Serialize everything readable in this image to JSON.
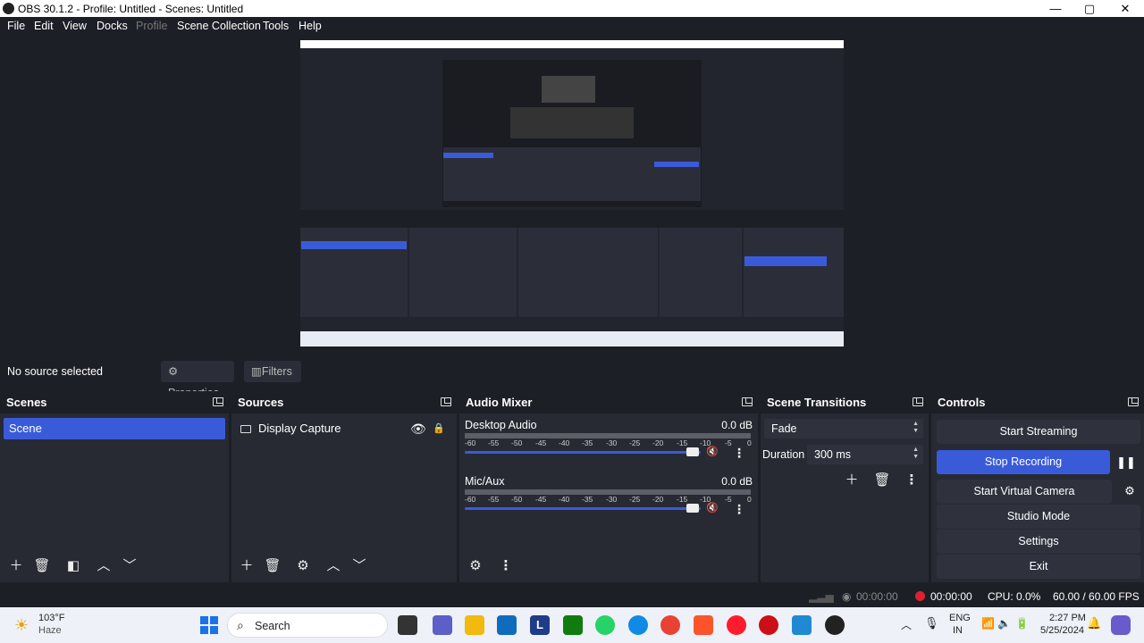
{
  "window": {
    "title": "OBS 30.1.2 - Profile: Untitled - Scenes: Untitled",
    "controls": {
      "minimize": "—",
      "maximize": "▢",
      "close": "✕"
    }
  },
  "menu": [
    "File",
    "Edit",
    "View",
    "Docks",
    "Profile",
    "Scene Collection",
    "Tools",
    "Help"
  ],
  "source_toolbar": {
    "status": "No source selected",
    "properties": "Properties",
    "filters": "Filters"
  },
  "docks": {
    "scenes": {
      "title": "Scenes",
      "items": [
        "Scene"
      ]
    },
    "sources": {
      "title": "Sources",
      "items": [
        "Display Capture"
      ]
    },
    "mixer": {
      "title": "Audio Mixer",
      "channels": [
        {
          "name": "Desktop Audio",
          "db": "0.0 dB"
        },
        {
          "name": "Mic/Aux",
          "db": "0.0 dB"
        }
      ],
      "scale": [
        "-60",
        "-55",
        "-50",
        "-45",
        "-40",
        "-35",
        "-30",
        "-25",
        "-20",
        "-15",
        "-10",
        "-5",
        "0"
      ]
    },
    "transitions": {
      "title": "Scene Transitions",
      "transition": "Fade",
      "duration_label": "Duration",
      "duration_value": "300 ms"
    },
    "controls": {
      "title": "Controls",
      "buttons": [
        "Start Streaming",
        "Stop Recording",
        "Start Virtual Camera",
        "Studio Mode",
        "Settings",
        "Exit"
      ]
    }
  },
  "statusbar": {
    "stream_time": "00:00:00",
    "rec_time": "00:00:00",
    "cpu": "CPU: 0.0%",
    "fps": "60.00 / 60.00 FPS"
  },
  "taskbar": {
    "weather_temp": "103°F",
    "weather_desc": "Haze",
    "search": "Search",
    "lang1": "ENG",
    "lang2": "IN",
    "time": "2:27 PM",
    "date": "5/25/2024"
  },
  "colors": {
    "accent": "#3a5bd9",
    "bg": "#1d1f26",
    "panel": "#272a33",
    "record": "#e0202e"
  }
}
